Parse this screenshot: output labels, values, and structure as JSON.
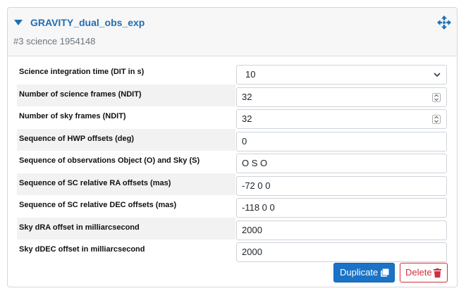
{
  "template": {
    "title": "GRAVITY_dual_obs_exp",
    "subtitle": "#3 science 1954148"
  },
  "params": [
    {
      "label": "Science integration time (DIT in s)",
      "value": "10",
      "control": "select"
    },
    {
      "label": "Number of science frames (NDIT)",
      "value": "32",
      "control": "spinner"
    },
    {
      "label": "Number of sky frames (NDIT)",
      "value": "32",
      "control": "spinner"
    },
    {
      "label": "Sequence of HWP offsets (deg)",
      "value": "0",
      "control": "text"
    },
    {
      "label": "Sequence of observations Object (O) and Sky (S)",
      "value": "O S O",
      "control": "text"
    },
    {
      "label": "Sequence of SC relative RA offsets (mas)",
      "value": "-72 0 0",
      "control": "text"
    },
    {
      "label": "Sequence of SC relative DEC offsets (mas)",
      "value": "-118 0 0",
      "control": "text"
    },
    {
      "label": "Sky dRA offset in milliarcsecond",
      "value": "2000",
      "control": "text"
    },
    {
      "label": "Sky dDEC offset in milliarcsecond",
      "value": "2000",
      "control": "text"
    }
  ],
  "actions": {
    "duplicate_label": "Duplicate",
    "delete_label": "Delete"
  },
  "colors": {
    "accent": "#1e6fb3",
    "primary_button": "#1a73c6",
    "danger": "#d0303c",
    "row_shade": "#f2f2f2"
  },
  "icons": {
    "collapse": "caret-down-icon",
    "move": "move-arrows-icon",
    "select": "chevron-down-icon",
    "spinner": "spinner-arrows-icon",
    "duplicate": "copy-icon",
    "delete": "trash-icon"
  }
}
